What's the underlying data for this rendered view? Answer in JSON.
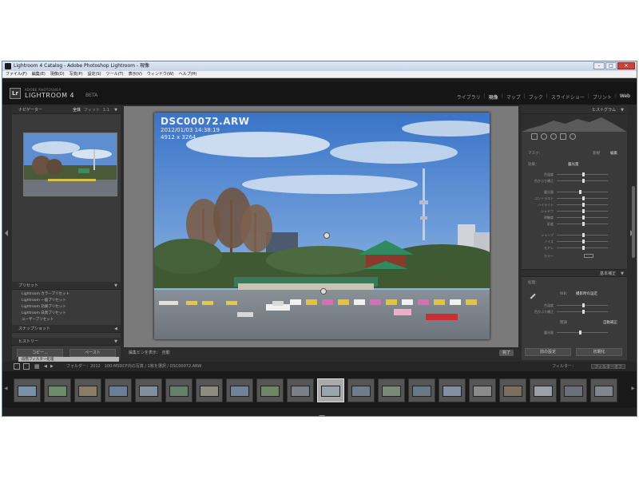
{
  "window": {
    "title": "Lightroom 4 Catalog - Adobe Photoshop Lightroom - 現像",
    "minimize": "–",
    "maximize": "□",
    "close": "✕"
  },
  "menu": [
    "ファイル(F)",
    "編集(E)",
    "現像(D)",
    "写真(P)",
    "設定(S)",
    "ツール(T)",
    "表示(V)",
    "ウィンドウ(W)",
    "ヘルプ(H)"
  ],
  "identity": {
    "logo": "Lr",
    "sub": "ADOBE PHOTOSHOP",
    "name": "LIGHTROOM 4",
    "beta": "BETA"
  },
  "modules": [
    "ライブラリ",
    "現像",
    "マップ",
    "ブック",
    "スライドショー",
    "プリント",
    "Web"
  ],
  "modules_separator": "|",
  "left_panel": {
    "navigator": "ナビゲーター",
    "nav_tabs": [
      "全体",
      "フィット",
      "1:1"
    ],
    "presets": "プリセット",
    "preset_items": [
      "Lightroom カラープリセット",
      "Lightroom 一般プリセット",
      "Lightroom 効果プリセット",
      "Lightroom 白黒プリセット",
      "ユーザープリセット"
    ],
    "snapshots": "スナップショット",
    "history": "ヒストリー",
    "history_items": [
      "段階フィルター処理",
      "段階フィルター処理",
      "段階フィルター処理",
      "段階フィルター処理",
      "段階フィルター処理",
      "段階フィルター処理",
      "段階フィルター処理"
    ],
    "copy_button": "コピー...",
    "paste_button": "ペースト"
  },
  "photo": {
    "filename": "DSC00072.ARW",
    "datetime": "2012/01/03 14:38:19",
    "dimensions": "4912 x 3264"
  },
  "toolbar": {
    "label": "編集ピンを表示：",
    "value": "自動",
    "done": "完了"
  },
  "right_panel": {
    "histogram": "ヒストグラム",
    "mask": "マスク：",
    "mask_new": "新規",
    "mask_edit": "編集",
    "effect": "効果：",
    "effect_value": "露光量",
    "sliders": [
      "色温度",
      "色かぶり補正",
      "露光量",
      "コントラスト",
      "ハイライト",
      "シャドウ",
      "明瞭度",
      "彩度",
      "シャープ",
      "ノイズ",
      "モアレ",
      "カラー"
    ],
    "basic": "基本補正",
    "treatment": "処理：",
    "wb": "WB：",
    "wb_value": "撮影時の設定",
    "tone": "階調",
    "auto_tone": "自動補正",
    "prev_button": "前の設定",
    "reset_button": "初期化"
  },
  "filmstrip": {
    "info": "フォルダー：2012　100-MSDCF内の写真 / 1枚を選択 / DSC00072.ARW",
    "filter": "フィルター：",
    "filter_value": "フィルターオフ"
  }
}
